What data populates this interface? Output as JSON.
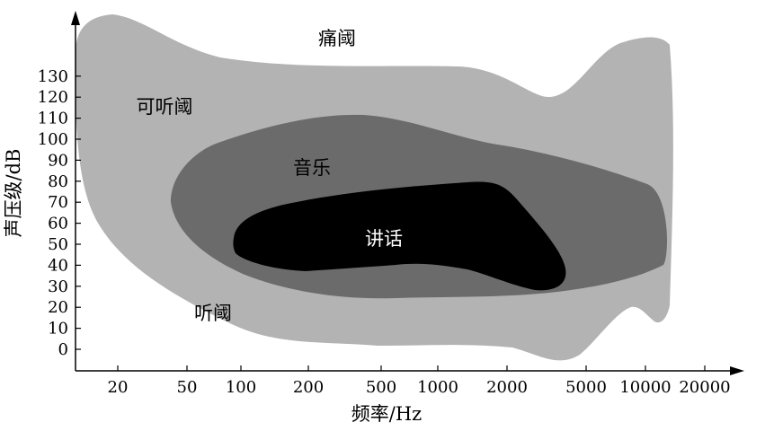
{
  "diagram": {
    "x_axis": {
      "title": "频率/Hz",
      "ticks": [
        "20",
        "50",
        "100",
        "200",
        "500",
        "1000",
        "2000",
        "5000",
        "10000",
        "20000"
      ]
    },
    "y_axis": {
      "title": "声压级/dB",
      "ticks": [
        "0",
        "10",
        "20",
        "30",
        "40",
        "50",
        "60",
        "70",
        "80",
        "90",
        "100",
        "110",
        "120",
        "130"
      ]
    },
    "regions": [
      {
        "key": "audible",
        "label_top": "痛阈",
        "label_left": "可听阈",
        "label_bottom": "听阈",
        "color": "#b3b3b3"
      },
      {
        "key": "music",
        "label": "音乐",
        "color": "#6b6b6b"
      },
      {
        "key": "speech",
        "label": "讲话",
        "color": "#000000"
      }
    ],
    "colors": {
      "axis": "#000000",
      "background": "#ffffff",
      "label_on_dark": "#ffffff",
      "label_on_light": "#000000"
    }
  }
}
